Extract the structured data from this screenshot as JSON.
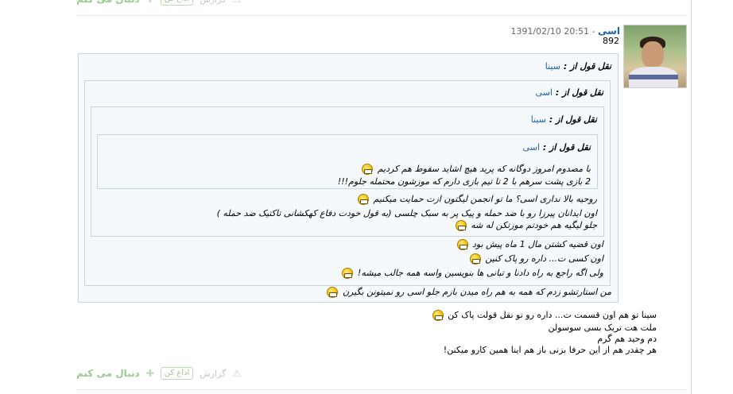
{
  "actions": {
    "follow_label": "دنبال می کنم",
    "share_label": "اداع کن",
    "report_label": "گزارش"
  },
  "post": {
    "username": "اسی",
    "datetime": "1391/02/10 20:51",
    "separator": " - ",
    "post_count": "892",
    "quote_label": "نقل قول از :",
    "quote1": {
      "from": "سینا",
      "quote2": {
        "from": "اسی",
        "quote3": {
          "from": "سینا",
          "quote4": {
            "from": "اسی",
            "lines": [
              "با مصدوم امروز دوگانه که پرید هیچ اشاید سقوط هم کردیم",
              "2 بازی پشت سرهم با 2 تا تیم بازی دارم که موزشون محتمله جلوم!!!"
            ]
          },
          "lines": [
            "روحیه بالا نداری اسی؟ ما تو انجمن لیگتون ازت حمایت میکنیم",
            "اون ایدانان پیرزا رو با ضد حمله و پیک پر به سبک چلسی (به قول خودت دفاع کهکشانی تاکتیک ضد حمله )",
            "جلو لیگیه هم خودتم موزتکن له شه"
          ]
        },
        "lines": [
          "اون قضیه کشتن مال 1 ماه پیش بود",
          "اون کسی ت... داره رو پاک کنین",
          "ولی اگه راجع به راه دادنا و تبانی ها بنویسین واسه همه جالب میشه!"
        ]
      },
      "lines": [
        "من استارتشو زدم که همه به هم راه میدن بازم جلو اسی رو نمیتونن بگیرن"
      ]
    },
    "body_lines": [
      "سینا تو هم اون قسمت ت... داره رو تو نقل قولت پاک کن",
      "ملت هت تریک بسی سوسولن",
      "دم وحید هم گرم",
      "هر چقدر هم از این حرفا بزنی باز هم اینا همین کارو میکنن!"
    ]
  }
}
